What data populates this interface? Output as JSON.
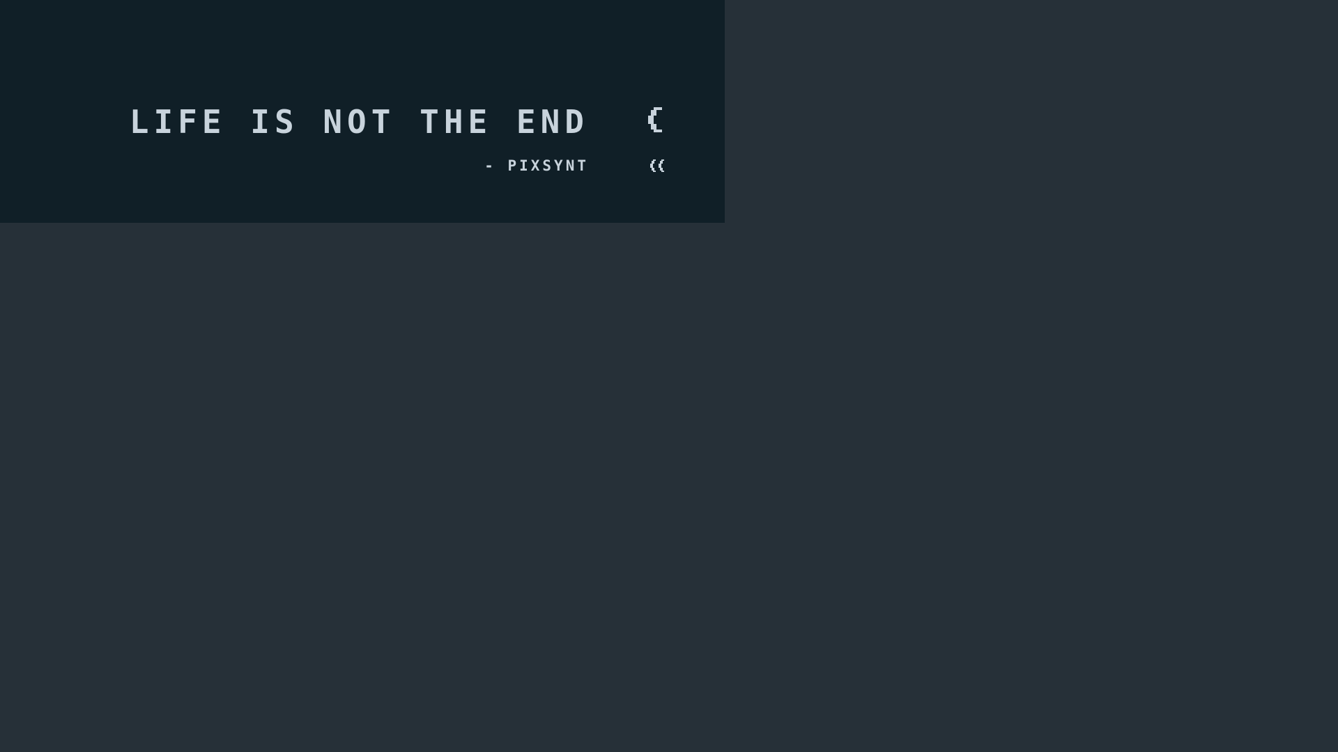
{
  "quote": {
    "text": "LIFE IS NOT THE END",
    "author": "- PIXSYNT"
  },
  "colors": {
    "background": "#263038",
    "panel": "#101f27",
    "text": "#c8d3dc"
  },
  "icons": {
    "large": "pixel-glitch-icon",
    "small": "pixel-double-arrow-icon"
  }
}
